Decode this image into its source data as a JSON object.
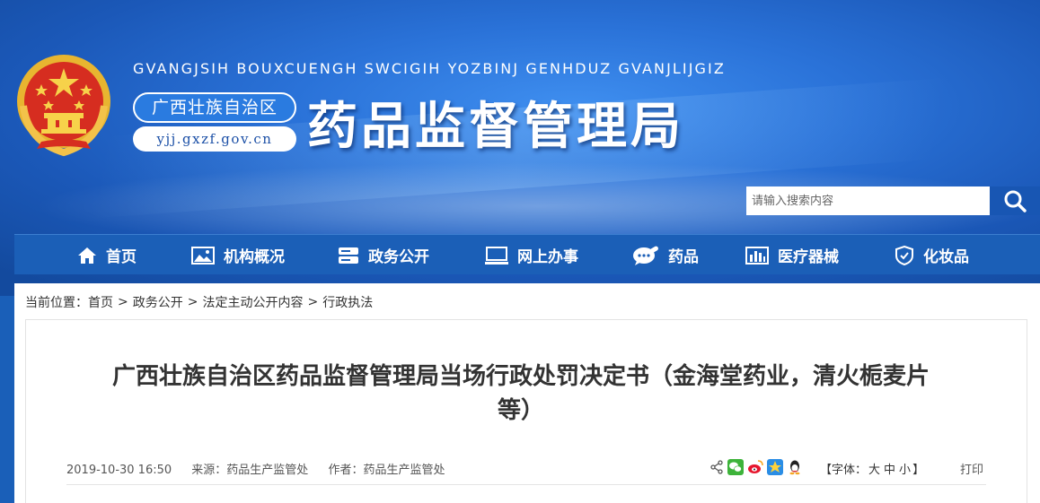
{
  "header": {
    "romanized": "GVANGJSIH BOUXCUENGH SWCIGIH YOZBINJ GENHDUZ GVANJLIJGIZ",
    "region": "广西壮族自治区",
    "url": "yjj.gxzf.gov.cn",
    "title": "药品监督管理局",
    "search_placeholder": "请输入搜索内容"
  },
  "nav": {
    "items": [
      {
        "label": "首页",
        "icon": "home-icon"
      },
      {
        "label": "机构概况",
        "icon": "image-icon"
      },
      {
        "label": "政务公开",
        "icon": "server-icon"
      },
      {
        "label": "网上办事",
        "icon": "monitor-icon"
      },
      {
        "label": "药品",
        "icon": "pill-chat-icon"
      },
      {
        "label": "医疗器械",
        "icon": "bar-chart-icon"
      },
      {
        "label": "化妆品",
        "icon": "shield-icon"
      }
    ]
  },
  "breadcrumb": {
    "prefix": "当前位置：",
    "items": [
      "首页",
      "政务公开",
      "法定主动公开内容",
      "行政执法"
    ],
    "separator": ">"
  },
  "article": {
    "title_line1": "广西壮族自治区药品监督管理局当场行政处罚决定书（金海堂药业，清火栀麦片",
    "title_line2": "等）",
    "date": "2019-10-30 16:50",
    "source": "来源：药品生产监管处",
    "author": "作者：药品生产监管处",
    "font_label": "【字体：",
    "font_large": "大",
    "font_medium": "中",
    "font_small": "小",
    "font_close": "】",
    "print": "打印"
  },
  "share": {
    "icons": [
      "share-icon",
      "wechat-icon",
      "weibo-icon",
      "qzone-icon",
      "qq-icon"
    ]
  },
  "colors": {
    "nav_bg": "#1b5fb7",
    "banner": "#2a72d8",
    "title_text": "#333333"
  }
}
